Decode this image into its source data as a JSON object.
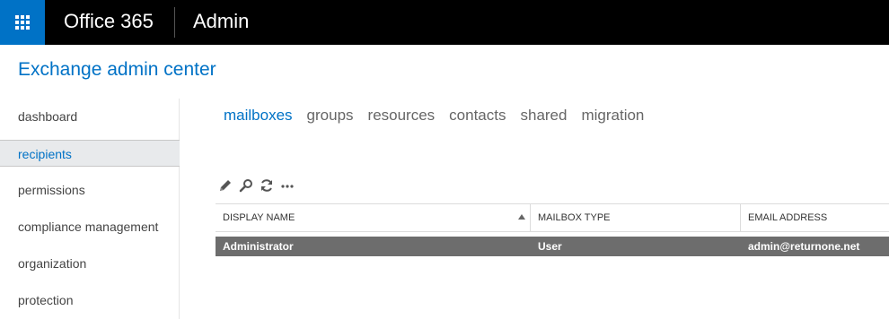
{
  "topbar": {
    "brand": "Office 365",
    "app": "Admin",
    "colors": {
      "bar": "#000000",
      "waffle": "#0072c6"
    }
  },
  "header": {
    "title": "Exchange admin center"
  },
  "nav": {
    "items": [
      {
        "label": "dashboard",
        "selected": false
      },
      {
        "label": "recipients",
        "selected": true
      },
      {
        "label": "permissions",
        "selected": false
      },
      {
        "label": "compliance management",
        "selected": false
      },
      {
        "label": "organization",
        "selected": false
      },
      {
        "label": "protection",
        "selected": false
      }
    ]
  },
  "tabs": [
    {
      "label": "mailboxes",
      "active": true
    },
    {
      "label": "groups",
      "active": false
    },
    {
      "label": "resources",
      "active": false
    },
    {
      "label": "contacts",
      "active": false
    },
    {
      "label": "shared",
      "active": false
    },
    {
      "label": "migration",
      "active": false
    }
  ],
  "toolbar": {
    "icons": [
      "pencil-icon",
      "search-icon",
      "refresh-icon",
      "more-icon"
    ]
  },
  "table": {
    "columns": [
      {
        "label": "DISPLAY NAME",
        "sorted": "ascending"
      },
      {
        "label": "MAILBOX TYPE"
      },
      {
        "label": "EMAIL ADDRESS"
      }
    ],
    "rows": [
      {
        "display_name": "Administrator",
        "mailbox_type": "User",
        "email": "admin@returnone.net",
        "selected": true
      }
    ]
  },
  "colors": {
    "accent": "#0072c6",
    "selected_row": "#6d6d6d",
    "nav_selected": "#e8eaec"
  }
}
